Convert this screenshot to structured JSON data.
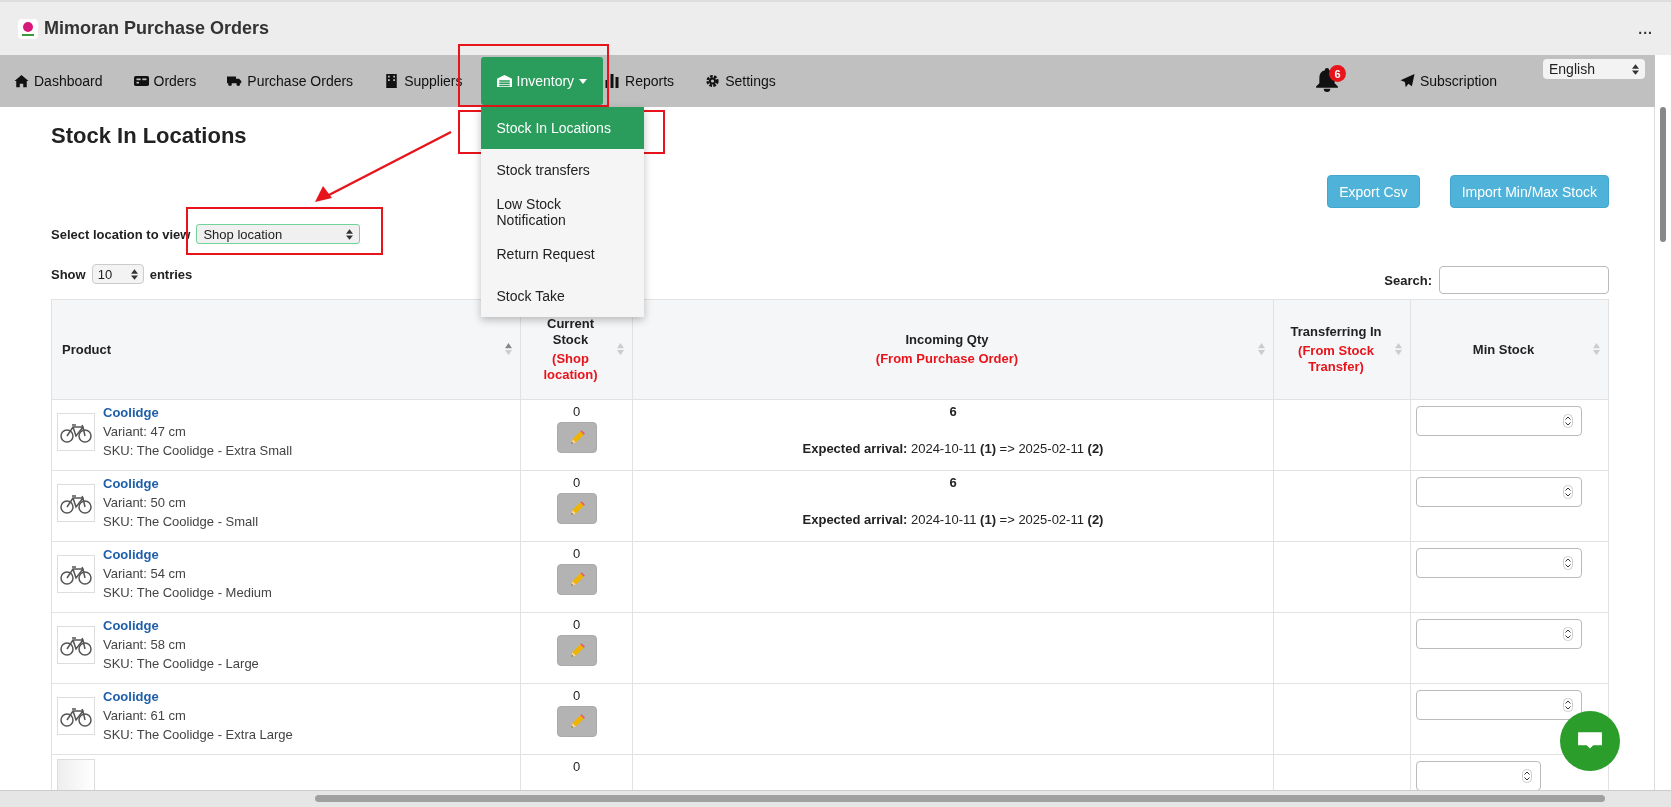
{
  "app": {
    "title": "Mimoran Purchase Orders",
    "menu": "..."
  },
  "nav": {
    "items": [
      {
        "label": "Dashboard",
        "selected": false,
        "dropdown": false
      },
      {
        "label": "Orders",
        "selected": false,
        "dropdown": false
      },
      {
        "label": "Purchase Orders",
        "selected": false,
        "dropdown": false
      },
      {
        "label": "Suppliers",
        "selected": false,
        "dropdown": false
      },
      {
        "label": "Inventory",
        "selected": true,
        "dropdown": true
      },
      {
        "label": "Reports",
        "selected": false,
        "dropdown": false
      },
      {
        "label": "Settings",
        "selected": false,
        "dropdown": false
      }
    ],
    "notifications": "6",
    "subscription": "Subscription",
    "language": "English"
  },
  "inventory_menu": [
    {
      "label": "Stock In Locations",
      "selected": true
    },
    {
      "label": "Stock transfers",
      "selected": false
    },
    {
      "label": "Low Stock Notification",
      "selected": false
    },
    {
      "label": "Return Request",
      "selected": false
    },
    {
      "label": "Stock Take",
      "selected": false
    }
  ],
  "page": {
    "title": "Stock In Locations",
    "buttons": [
      "Export Csv",
      "Import Min/Max Stock"
    ],
    "location_label": "Select location to view",
    "location": "Shop location",
    "show_label": "Show",
    "page_size": "10",
    "entries_label": "entries",
    "search_label": "Search:"
  },
  "table": {
    "columns": [
      {
        "title": "Product"
      },
      {
        "title": "Current Stock",
        "note": "(Shop location)"
      },
      {
        "title": "Incoming Qty",
        "note": "(From Purchase Order)"
      },
      {
        "title": "Transferring In",
        "note": "(From Stock Transfer)"
      },
      {
        "title": "Min Stock"
      }
    ],
    "rows": [
      {
        "kind": "full",
        "name": "Coolidge",
        "variant": "Variant: 47 cm",
        "sku": "SKU: The Coolidge - Extra Small",
        "stock": "0",
        "incoming": "6",
        "arrival": "**Expected arrival:** 2024-10-11 **(1)** => 2025-02-11 **(2)**"
      },
      {
        "kind": "full",
        "name": "Coolidge",
        "variant": "Variant: 50 cm",
        "sku": "SKU: The Coolidge - Small",
        "stock": "0",
        "incoming": "6",
        "arrival": "**Expected arrival:** 2024-10-11 **(1)** => 2025-02-11 **(2)**"
      },
      {
        "kind": "full",
        "name": "Coolidge",
        "variant": "Variant: 54 cm",
        "sku": "SKU: The Coolidge - Medium",
        "stock": "0"
      },
      {
        "kind": "full",
        "name": "Coolidge",
        "variant": "Variant: 58 cm",
        "sku": "SKU: The Coolidge - Large",
        "stock": "0"
      },
      {
        "kind": "full",
        "name": "Coolidge",
        "variant": "Variant: 61 cm",
        "sku": "SKU: The Coolidge - Extra Large",
        "stock": "0"
      },
      {
        "kind": "partial",
        "stock": "0"
      }
    ]
  }
}
